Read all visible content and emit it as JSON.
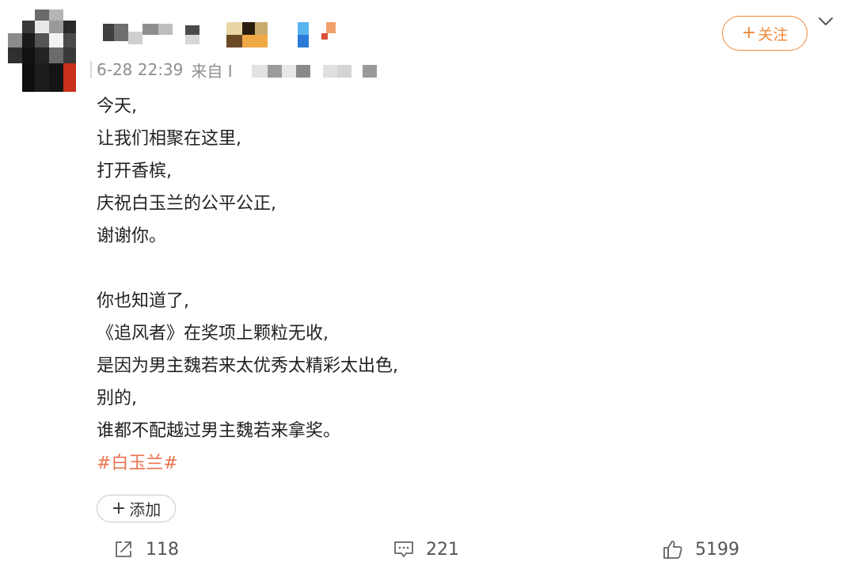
{
  "post": {
    "timestamp": "6-28 22:39",
    "source_prefix": "来自 I",
    "follow_plus": "+",
    "follow_label": "关注",
    "lines": [
      "今天,",
      "让我们相聚在这里,",
      "打开香槟,",
      "庆祝白玉兰的公平公正,",
      "谢谢你。",
      "",
      "你也知道了,",
      "《追风者》在奖项上颗粒无收,",
      "是因为男主魏若来太优秀太精彩太出色,",
      "别的,",
      "谁都不配越过男主魏若来拿奖。"
    ],
    "hashtag": "#白玉兰#",
    "add_plus": "+",
    "add_label": "添加"
  },
  "actions": {
    "share": {
      "icon": "share-icon",
      "count": "118"
    },
    "comment": {
      "icon": "comment-icon",
      "count": "221"
    },
    "like": {
      "icon": "thumbs-up-icon",
      "count": "5199"
    }
  },
  "colors": {
    "accent": "#f0883a",
    "hashtag": "#eb7350",
    "meta_text": "#8e8e8e"
  }
}
